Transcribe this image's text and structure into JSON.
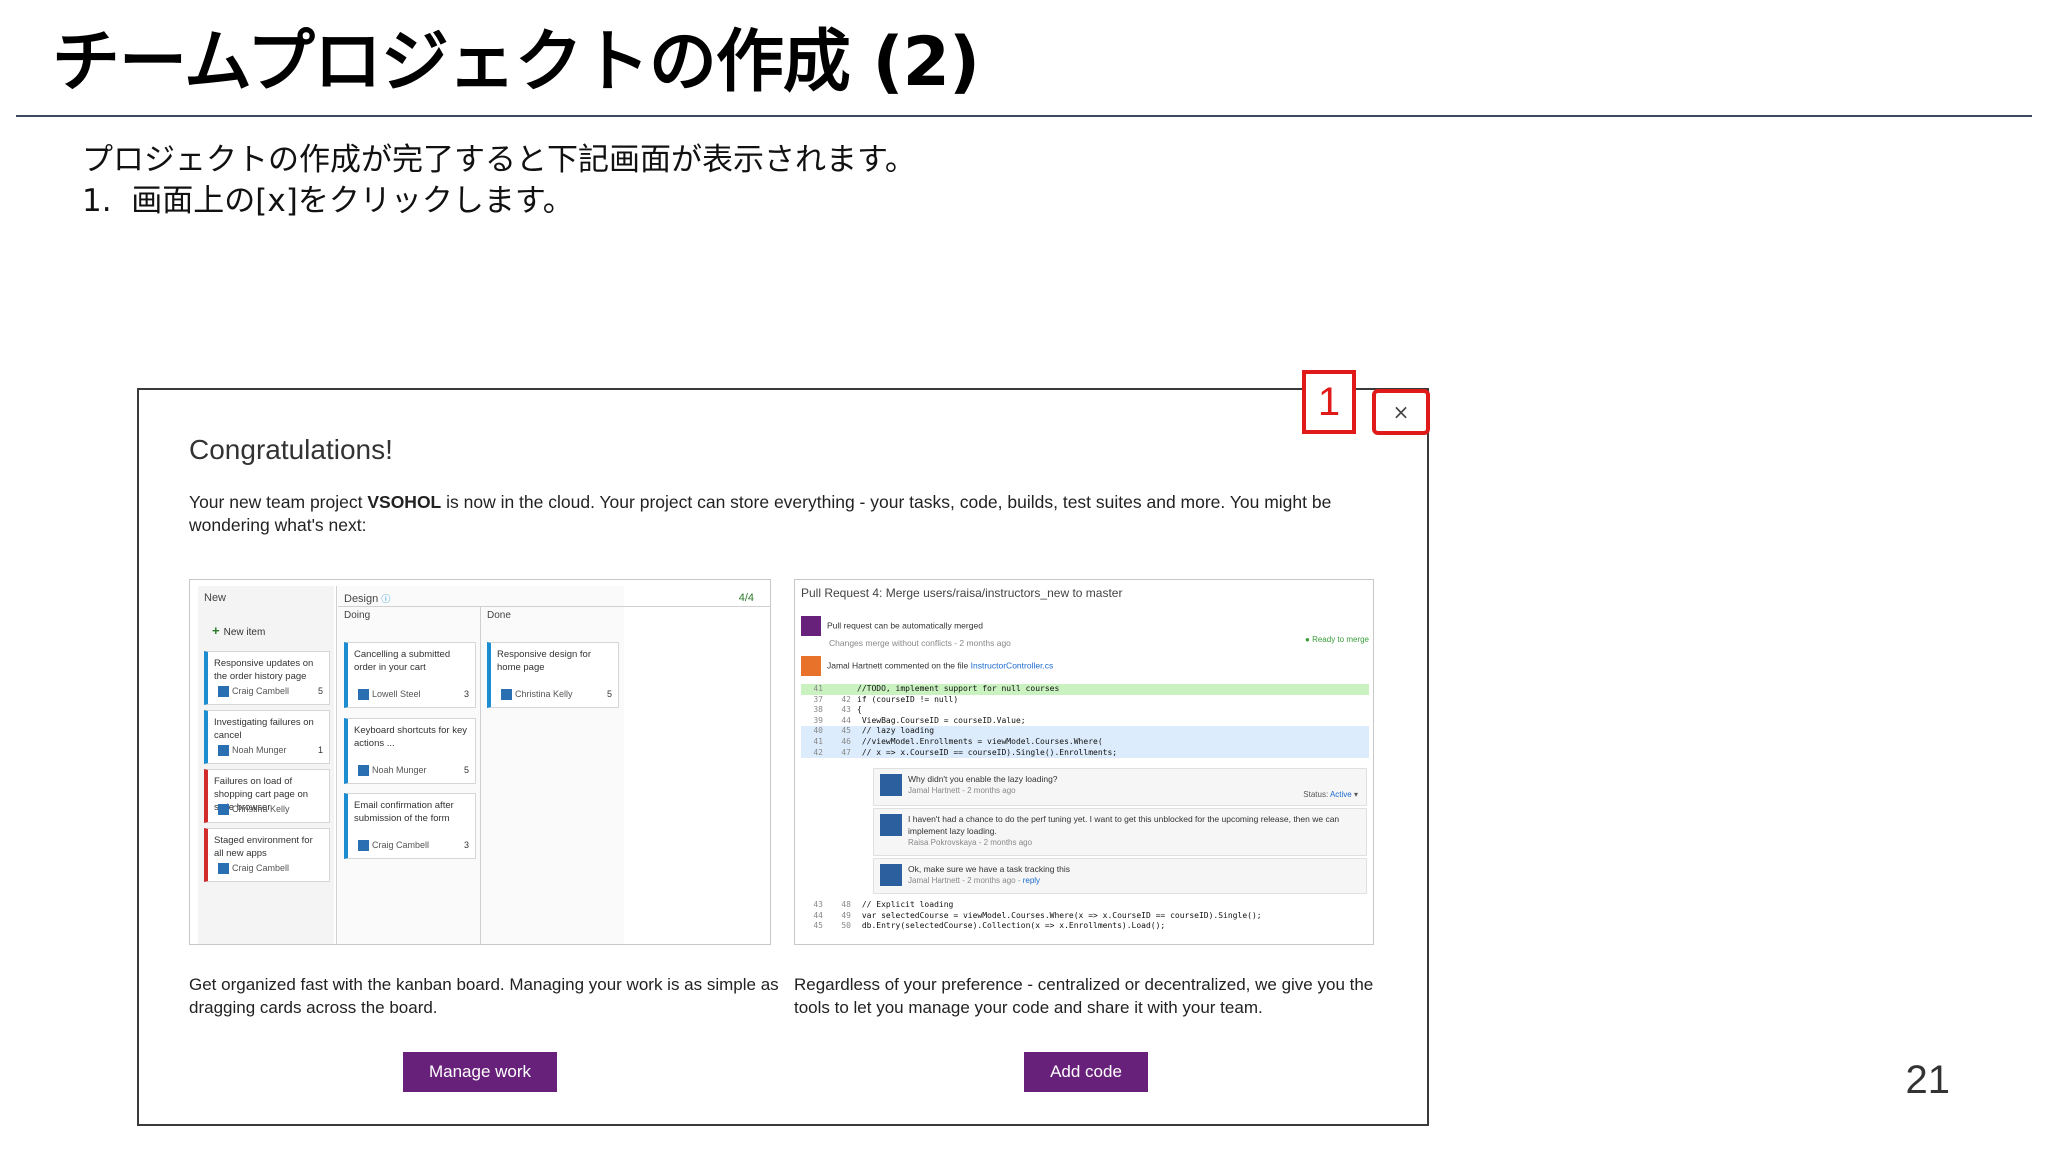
{
  "slide": {
    "title": "チームプロジェクトの作成 (2)",
    "instructions": [
      "プロジェクトの作成が完了すると下記画面が表示されます。",
      "1.  画面上の[x]をクリックします。"
    ],
    "page_number": "21",
    "callout_number": "1",
    "accent_color": "#e01919"
  },
  "dialog": {
    "title": "Congratulations!",
    "close_label": "×",
    "intro_before": "Your new team project ",
    "project_name": "VSOHOL",
    "intro_after": " is now in the cloud. Your project can store everything - your tasks, code, builds, test suites and more. You might be wondering what's next:",
    "kanban": {
      "col_new": "New",
      "col_design": "Design",
      "col_count": "4/4",
      "sub_doing": "Doing",
      "sub_done": "Done",
      "new_item": "New item",
      "cards": [
        {
          "title": "Responsive updates on the order history page",
          "who": "Craig Cambell",
          "est": "5"
        },
        {
          "title": "Investigating failures on cancel",
          "who": "Noah Munger",
          "est": "1"
        },
        {
          "title": "Failures on load of shopping cart page on stale browser",
          "who": "Christina Kelly",
          "est": ""
        },
        {
          "title": "Staged environment for all new apps",
          "who": "Craig Cambell",
          "est": ""
        },
        {
          "title": "Cancelling a submitted order in your cart",
          "who": "Lowell Steel",
          "est": "3"
        },
        {
          "title": "Keyboard shortcuts for key actions ...",
          "who": "Noah Munger",
          "est": "5"
        },
        {
          "title": "Email confirmation after submission of the form",
          "who": "Craig Cambell",
          "est": "3"
        },
        {
          "title": "Responsive design for home page",
          "who": "Christina Kelly",
          "est": "5"
        }
      ]
    },
    "pull_request": {
      "title": "Pull Request 4: Merge users/raisa/instructors_new to master",
      "merge_status": "Pull request can be automatically merged",
      "merge_sub": "Changes merge without conflicts - 2 months ago",
      "ready": "Ready to merge",
      "comment_before": "Jamal Hartnett commented on the file ",
      "comment_file": "InstructorController.cs",
      "code_top": [
        {
          "a": "41",
          "b": "",
          "t": "//TODO, implement support for null courses"
        },
        {
          "a": "37",
          "b": "42",
          "t": "if (courseID != null)"
        },
        {
          "a": "38",
          "b": "43",
          "t": "{"
        },
        {
          "a": "39",
          "b": "44",
          "t": "    ViewBag.CourseID = courseID.Value;"
        },
        {
          "a": "40",
          "b": "45",
          "t": "    // lazy loading"
        },
        {
          "a": "41",
          "b": "46",
          "t": "    //viewModel.Enrollments = viewModel.Courses.Where("
        },
        {
          "a": "42",
          "b": "47",
          "t": "    //    x => x.CourseID == courseID).Single().Enrollments;"
        }
      ],
      "thread": [
        {
          "text": "Why didn't you enable the lazy loading?",
          "meta": "Jamal Hartnett - 2 months ago"
        },
        {
          "text": "I haven't had a chance to do the perf tuning yet. I want to get this unblocked for the upcoming release, then we can implement lazy loading.",
          "meta": "Raisa Pokrovskaya - 2 months ago"
        },
        {
          "text": "Ok, make sure we have a task tracking this",
          "meta": "Jamal Hartnett - 2 months ago - ",
          "reply": "reply"
        }
      ],
      "status_label": "Status: ",
      "status_value": "Active",
      "code_bottom": [
        {
          "a": "43",
          "b": "48",
          "t": "    // Explicit loading"
        },
        {
          "a": "44",
          "b": "49",
          "t": "    var selectedCourse = viewModel.Courses.Where(x => x.CourseID == courseID).Single();"
        },
        {
          "a": "45",
          "b": "50",
          "t": "    db.Entry(selectedCourse).Collection(x => x.Enrollments).Load();"
        }
      ]
    },
    "left_desc": "Get organized fast with the kanban board. Managing your work is as simple as dragging cards across the board.",
    "right_desc": "Regardless of your preference - centralized or decentralized, we give you the tools to let you manage your code and share it with your team.",
    "manage_work_label": "Manage work",
    "add_code_label": "Add code",
    "button_color": "#68217a"
  }
}
